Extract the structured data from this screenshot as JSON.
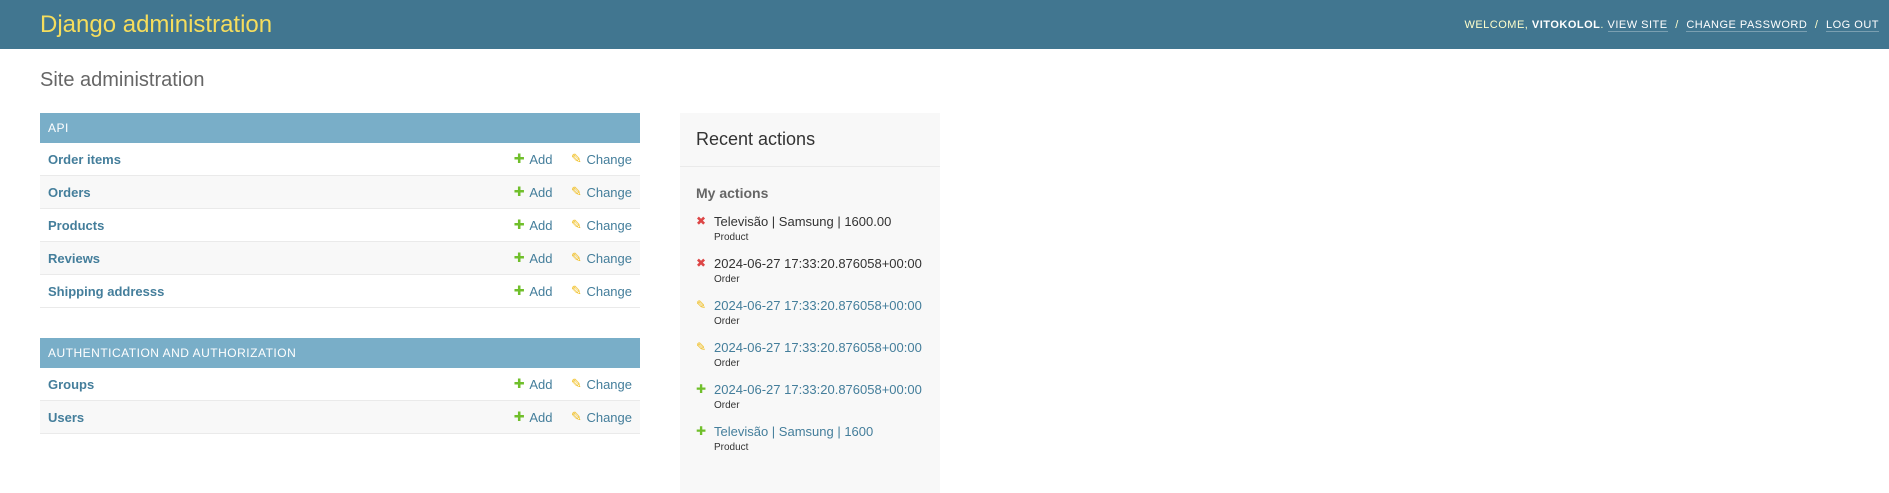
{
  "header": {
    "site_name": "Django administration",
    "welcome_text": "Welcome,",
    "username": "vitokolol",
    "view_site": "View site",
    "change_password": "Change password",
    "log_out": "Log out",
    "separator": "/"
  },
  "page_title": "Site administration",
  "apps": [
    {
      "caption": "API",
      "models": [
        {
          "name": "Order items",
          "add": "Add",
          "change": "Change"
        },
        {
          "name": "Orders",
          "add": "Add",
          "change": "Change"
        },
        {
          "name": "Products",
          "add": "Add",
          "change": "Change"
        },
        {
          "name": "Reviews",
          "add": "Add",
          "change": "Change"
        },
        {
          "name": "Shipping addresss",
          "add": "Add",
          "change": "Change"
        }
      ]
    },
    {
      "caption": "Authentication and Authorization",
      "models": [
        {
          "name": "Groups",
          "add": "Add",
          "change": "Change"
        },
        {
          "name": "Users",
          "add": "Add",
          "change": "Change"
        }
      ]
    }
  ],
  "sidebar": {
    "title": "Recent actions",
    "subtitle": "My actions",
    "actions": [
      {
        "kind": "delete",
        "icon": "delete-icon",
        "title": "Televisão | Samsung | 1600.00",
        "type": "Product",
        "is_link": false
      },
      {
        "kind": "delete",
        "icon": "delete-icon",
        "title": "2024-06-27 17:33:20.876058+00:00",
        "type": "Order",
        "is_link": false
      },
      {
        "kind": "change",
        "icon": "pencil-icon",
        "title": "2024-06-27 17:33:20.876058+00:00",
        "type": "Order",
        "is_link": true
      },
      {
        "kind": "change",
        "icon": "pencil-icon",
        "title": "2024-06-27 17:33:20.876058+00:00",
        "type": "Order",
        "is_link": true
      },
      {
        "kind": "add",
        "icon": "plus-icon",
        "title": "2024-06-27 17:33:20.876058+00:00",
        "type": "Order",
        "is_link": true
      },
      {
        "kind": "add",
        "icon": "plus-icon",
        "title": "Televisão | Samsung | 1600",
        "type": "Product",
        "is_link": true
      }
    ]
  },
  "colors": {
    "header_bg": "#417690",
    "brand": "#f5dd5d",
    "caption_bg": "#79aec8",
    "link": "#447e9b",
    "add": "#70bf2b",
    "change": "#efb80b",
    "delete": "#dd4646"
  }
}
